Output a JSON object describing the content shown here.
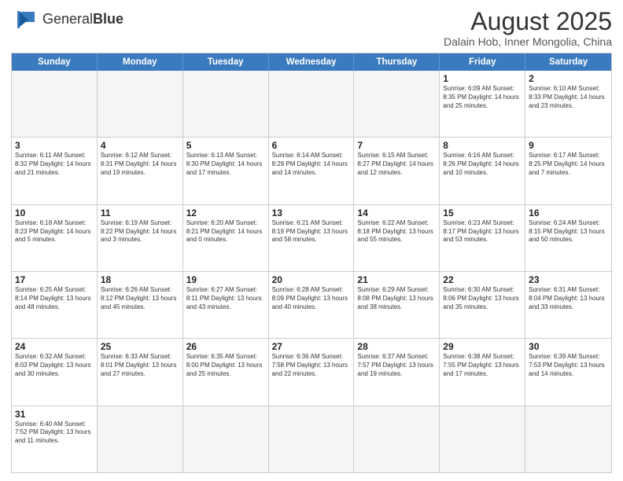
{
  "logo": {
    "general": "General",
    "blue": "Blue"
  },
  "header": {
    "title": "August 2025",
    "subtitle": "Dalain Hob, Inner Mongolia, China"
  },
  "weekdays": [
    "Sunday",
    "Monday",
    "Tuesday",
    "Wednesday",
    "Thursday",
    "Friday",
    "Saturday"
  ],
  "rows": [
    [
      {
        "day": "",
        "info": "",
        "empty": true
      },
      {
        "day": "",
        "info": "",
        "empty": true
      },
      {
        "day": "",
        "info": "",
        "empty": true
      },
      {
        "day": "",
        "info": "",
        "empty": true
      },
      {
        "day": "",
        "info": "",
        "empty": true
      },
      {
        "day": "1",
        "info": "Sunrise: 6:09 AM\nSunset: 8:35 PM\nDaylight: 14 hours and 25 minutes."
      },
      {
        "day": "2",
        "info": "Sunrise: 6:10 AM\nSunset: 8:33 PM\nDaylight: 14 hours and 23 minutes."
      }
    ],
    [
      {
        "day": "3",
        "info": "Sunrise: 6:11 AM\nSunset: 8:32 PM\nDaylight: 14 hours and 21 minutes."
      },
      {
        "day": "4",
        "info": "Sunrise: 6:12 AM\nSunset: 8:31 PM\nDaylight: 14 hours and 19 minutes."
      },
      {
        "day": "5",
        "info": "Sunrise: 6:13 AM\nSunset: 8:30 PM\nDaylight: 14 hours and 17 minutes."
      },
      {
        "day": "6",
        "info": "Sunrise: 6:14 AM\nSunset: 8:29 PM\nDaylight: 14 hours and 14 minutes."
      },
      {
        "day": "7",
        "info": "Sunrise: 6:15 AM\nSunset: 8:27 PM\nDaylight: 14 hours and 12 minutes."
      },
      {
        "day": "8",
        "info": "Sunrise: 6:16 AM\nSunset: 8:26 PM\nDaylight: 14 hours and 10 minutes."
      },
      {
        "day": "9",
        "info": "Sunrise: 6:17 AM\nSunset: 8:25 PM\nDaylight: 14 hours and 7 minutes."
      }
    ],
    [
      {
        "day": "10",
        "info": "Sunrise: 6:18 AM\nSunset: 8:23 PM\nDaylight: 14 hours and 5 minutes."
      },
      {
        "day": "11",
        "info": "Sunrise: 6:19 AM\nSunset: 8:22 PM\nDaylight: 14 hours and 3 minutes."
      },
      {
        "day": "12",
        "info": "Sunrise: 6:20 AM\nSunset: 8:21 PM\nDaylight: 14 hours and 0 minutes."
      },
      {
        "day": "13",
        "info": "Sunrise: 6:21 AM\nSunset: 8:19 PM\nDaylight: 13 hours and 58 minutes."
      },
      {
        "day": "14",
        "info": "Sunrise: 6:22 AM\nSunset: 8:18 PM\nDaylight: 13 hours and 55 minutes."
      },
      {
        "day": "15",
        "info": "Sunrise: 6:23 AM\nSunset: 8:17 PM\nDaylight: 13 hours and 53 minutes."
      },
      {
        "day": "16",
        "info": "Sunrise: 6:24 AM\nSunset: 8:15 PM\nDaylight: 13 hours and 50 minutes."
      }
    ],
    [
      {
        "day": "17",
        "info": "Sunrise: 6:25 AM\nSunset: 8:14 PM\nDaylight: 13 hours and 48 minutes."
      },
      {
        "day": "18",
        "info": "Sunrise: 6:26 AM\nSunset: 8:12 PM\nDaylight: 13 hours and 45 minutes."
      },
      {
        "day": "19",
        "info": "Sunrise: 6:27 AM\nSunset: 8:11 PM\nDaylight: 13 hours and 43 minutes."
      },
      {
        "day": "20",
        "info": "Sunrise: 6:28 AM\nSunset: 8:09 PM\nDaylight: 13 hours and 40 minutes."
      },
      {
        "day": "21",
        "info": "Sunrise: 6:29 AM\nSunset: 8:08 PM\nDaylight: 13 hours and 38 minutes."
      },
      {
        "day": "22",
        "info": "Sunrise: 6:30 AM\nSunset: 8:06 PM\nDaylight: 13 hours and 35 minutes."
      },
      {
        "day": "23",
        "info": "Sunrise: 6:31 AM\nSunset: 8:04 PM\nDaylight: 13 hours and 33 minutes."
      }
    ],
    [
      {
        "day": "24",
        "info": "Sunrise: 6:32 AM\nSunset: 8:03 PM\nDaylight: 13 hours and 30 minutes."
      },
      {
        "day": "25",
        "info": "Sunrise: 6:33 AM\nSunset: 8:01 PM\nDaylight: 13 hours and 27 minutes."
      },
      {
        "day": "26",
        "info": "Sunrise: 6:35 AM\nSunset: 8:00 PM\nDaylight: 13 hours and 25 minutes."
      },
      {
        "day": "27",
        "info": "Sunrise: 6:36 AM\nSunset: 7:58 PM\nDaylight: 13 hours and 22 minutes."
      },
      {
        "day": "28",
        "info": "Sunrise: 6:37 AM\nSunset: 7:57 PM\nDaylight: 13 hours and 19 minutes."
      },
      {
        "day": "29",
        "info": "Sunrise: 6:38 AM\nSunset: 7:55 PM\nDaylight: 13 hours and 17 minutes."
      },
      {
        "day": "30",
        "info": "Sunrise: 6:39 AM\nSunset: 7:53 PM\nDaylight: 13 hours and 14 minutes."
      }
    ],
    [
      {
        "day": "31",
        "info": "Sunrise: 6:40 AM\nSunset: 7:52 PM\nDaylight: 13 hours and 11 minutes."
      },
      {
        "day": "",
        "info": "",
        "empty": true
      },
      {
        "day": "",
        "info": "",
        "empty": true
      },
      {
        "day": "",
        "info": "",
        "empty": true
      },
      {
        "day": "",
        "info": "",
        "empty": true
      },
      {
        "day": "",
        "info": "",
        "empty": true
      },
      {
        "day": "",
        "info": "",
        "empty": true
      }
    ]
  ]
}
